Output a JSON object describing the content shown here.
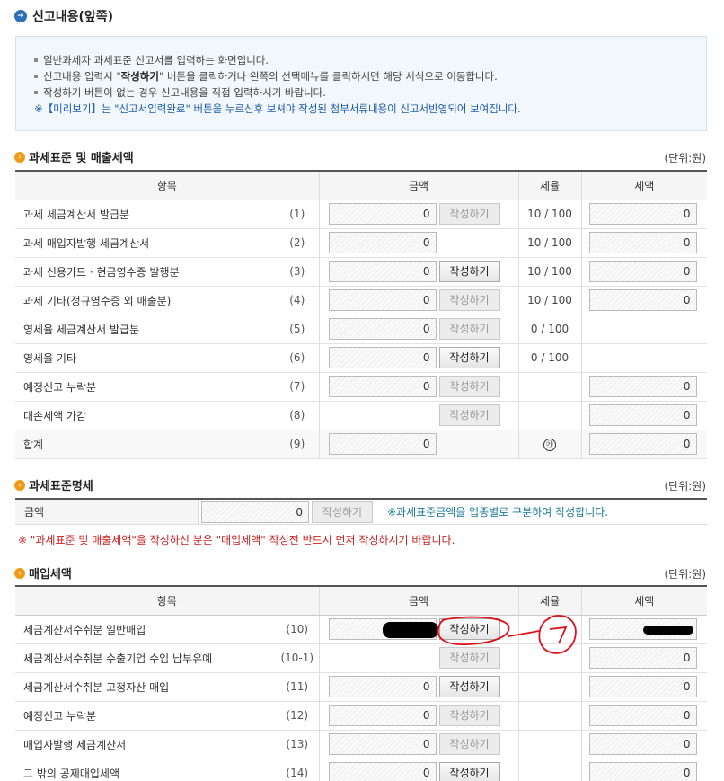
{
  "header": {
    "title": "신고내용(앞쪽)"
  },
  "notice": {
    "line1": "일반과세자 과세표준 신고서를 입력하는 화면입니다.",
    "line2_a": "신고내용 입력시 \"",
    "line2_b": "작성하기",
    "line2_c": "\" 버튼을 클릭하거나 왼쪽의 선택메뉴를 클릭하시면 해당 서식으로 이동합니다.",
    "line3": "작성하기 버튼이 없는 경우 신고내용을 직접 입력하시기 바랍니다.",
    "line4": "※【미리보기】는 \"신고서입력완료\" 버튼을 누르신후 보셔야 작성된 첨부서류내용이 신고서반영되어 보여집니다."
  },
  "unit_label": "(단위:원)",
  "section1": {
    "title": "과세표준 및 매출세액",
    "headers": [
      "항목",
      "금액",
      "세율",
      "세액"
    ],
    "rows": [
      {
        "label": "과세 세금계산서 발급분",
        "num": "(1)",
        "amount": "0",
        "button": "작성하기",
        "btn_enabled": false,
        "rate": "10 / 100",
        "tax": "0"
      },
      {
        "label": "과세 매입자발행 세금계산서",
        "num": "(2)",
        "amount": "0",
        "button": "",
        "btn_enabled": false,
        "rate": "10 / 100",
        "tax": "0"
      },
      {
        "label": "과세 신용카드 · 현금영수증 발행분",
        "num": "(3)",
        "amount": "0",
        "button": "작성하기",
        "btn_enabled": true,
        "rate": "10 / 100",
        "tax": "0"
      },
      {
        "label": "과세 기타(정규영수증 외 매출분)",
        "num": "(4)",
        "amount": "0",
        "button": "작성하기",
        "btn_enabled": false,
        "rate": "10 / 100",
        "tax": "0"
      },
      {
        "label": "영세율 세금계산서 발급분",
        "num": "(5)",
        "amount": "0",
        "button": "작성하기",
        "btn_enabled": false,
        "rate": "0 / 100",
        "tax": ""
      },
      {
        "label": "영세율 기타",
        "num": "(6)",
        "amount": "0",
        "button": "작성하기",
        "btn_enabled": true,
        "rate": "0 / 100",
        "tax": ""
      },
      {
        "label": "예정신고 누락분",
        "num": "(7)",
        "amount": "0",
        "button": "작성하기",
        "btn_enabled": false,
        "rate": "",
        "tax": "0"
      },
      {
        "label": "대손세액 가감",
        "num": "(8)",
        "amount": "",
        "button": "작성하기",
        "btn_enabled": false,
        "rate": "",
        "tax": "0"
      }
    ],
    "total": {
      "label": "합계",
      "num": "(9)",
      "amount": "0",
      "rate": "㉮",
      "tax": "0"
    }
  },
  "section2": {
    "title": "과세표준명세",
    "label": "금액",
    "amount": "0",
    "button": "작성하기",
    "note": "※과세표준금액을 업종별로 구분하여 작성합니다.",
    "warning": "※ \"과세표준 및 매출세액\"을 작성하신 분은 \"매입세액\" 작성전 반드시 먼저 작성하시기 바랍니다."
  },
  "section3": {
    "title": "매입세액",
    "headers": [
      "항목",
      "금액",
      "세율",
      "세액"
    ],
    "rows": [
      {
        "label": "세금계산서수취분 일반매입",
        "num": "(10)",
        "amount": "",
        "button": "작성하기",
        "btn_enabled": true,
        "tax": ""
      },
      {
        "label": "세금계산서수취분 수출기업 수입 납부유예",
        "num": "(10-1)",
        "amount": "",
        "button": "작성하기",
        "btn_enabled": false,
        "tax": "0"
      },
      {
        "label": "세금계산서수취분 고정자산 매입",
        "num": "(11)",
        "amount": "0",
        "button": "작성하기",
        "btn_enabled": true,
        "tax": "0"
      },
      {
        "label": "예정신고 누락분",
        "num": "(12)",
        "amount": "0",
        "button": "작성하기",
        "btn_enabled": false,
        "tax": "0"
      },
      {
        "label": "매입자발행 세금계산서",
        "num": "(13)",
        "amount": "0",
        "button": "작성하기",
        "btn_enabled": false,
        "tax": "0"
      },
      {
        "label": "그 밖의 공제매입세액",
        "num": "(14)",
        "amount": "0",
        "button": "작성하기",
        "btn_enabled": true,
        "tax": "0"
      }
    ]
  },
  "colors": {
    "accent_blue": "#2a6fb7",
    "accent_orange": "#f29a16",
    "warning_red": "#cc1f1f",
    "annotation_red": "#e0101a"
  }
}
